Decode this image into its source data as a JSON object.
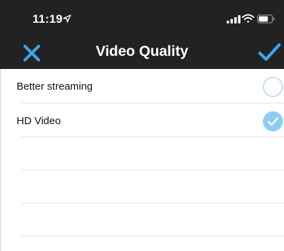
{
  "status_bar": {
    "time": "11:19",
    "icons": [
      "location-icon",
      "signal-icon",
      "wifi-icon",
      "battery-icon"
    ]
  },
  "nav_bar": {
    "title": "Video Quality",
    "left_action": "close-icon",
    "right_action": "checkmark-icon",
    "accent_color": "#3aa7e8"
  },
  "options": [
    {
      "label": "Better streaming",
      "selected": false
    },
    {
      "label": "HD Video",
      "selected": true
    }
  ],
  "colors": {
    "bar_background": "#222222",
    "selected_fill": "#8ecdf0",
    "unselected_border": "#a9d6f3"
  }
}
